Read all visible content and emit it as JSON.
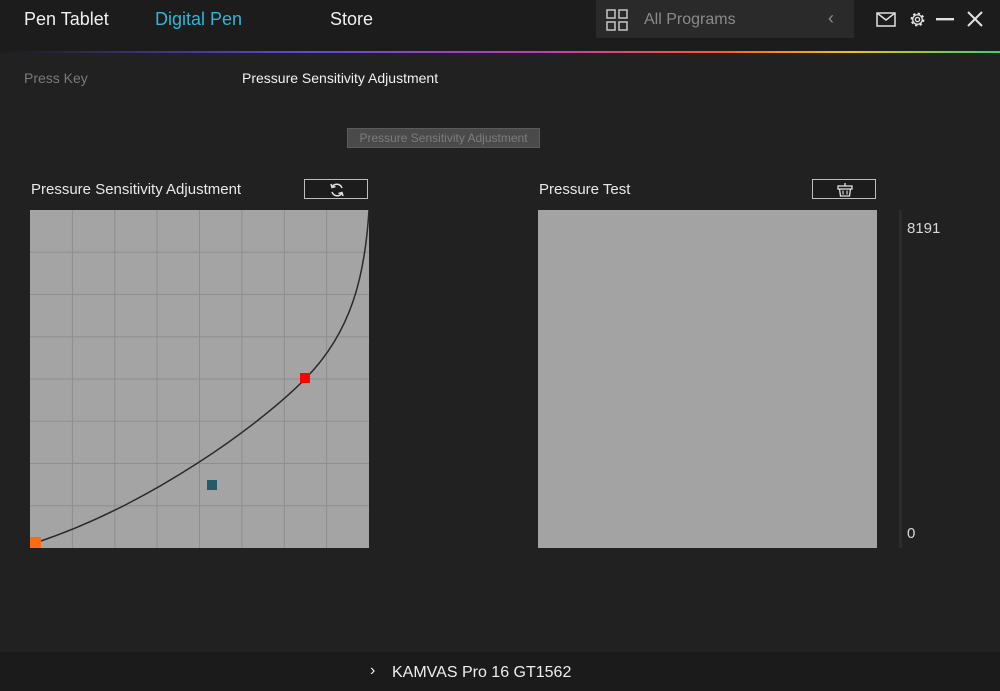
{
  "nav": {
    "tabs": [
      {
        "label": "Pen Tablet"
      },
      {
        "label": "Digital Pen"
      },
      {
        "label": "Store"
      }
    ],
    "programs_label": "All Programs",
    "icons": [
      "grid-icon",
      "chevron-left-icon",
      "mail-icon",
      "gear-icon",
      "minimize-icon",
      "close-icon"
    ]
  },
  "subtabs": [
    {
      "label": "Press Key"
    },
    {
      "label": "Pressure Sensitivity Adjustment"
    }
  ],
  "tooltip": "Pressure Sensitivity Adjustment",
  "pressure_panel": {
    "title": "Pressure Sensitivity Adjustment",
    "reset_icon": "refresh-icon"
  },
  "test_panel": {
    "title": "Pressure Test",
    "clear_icon": "basket-icon",
    "scale_max": "8191",
    "scale_min": "0"
  },
  "footer": {
    "device_name": "KAMVAS Pro 16 GT1562"
  },
  "colors": {
    "accent": "#2fb6d6",
    "control_point_high": "#ff0000",
    "control_point_low": "#245a6a",
    "origin_point": "#ff6a13"
  }
}
